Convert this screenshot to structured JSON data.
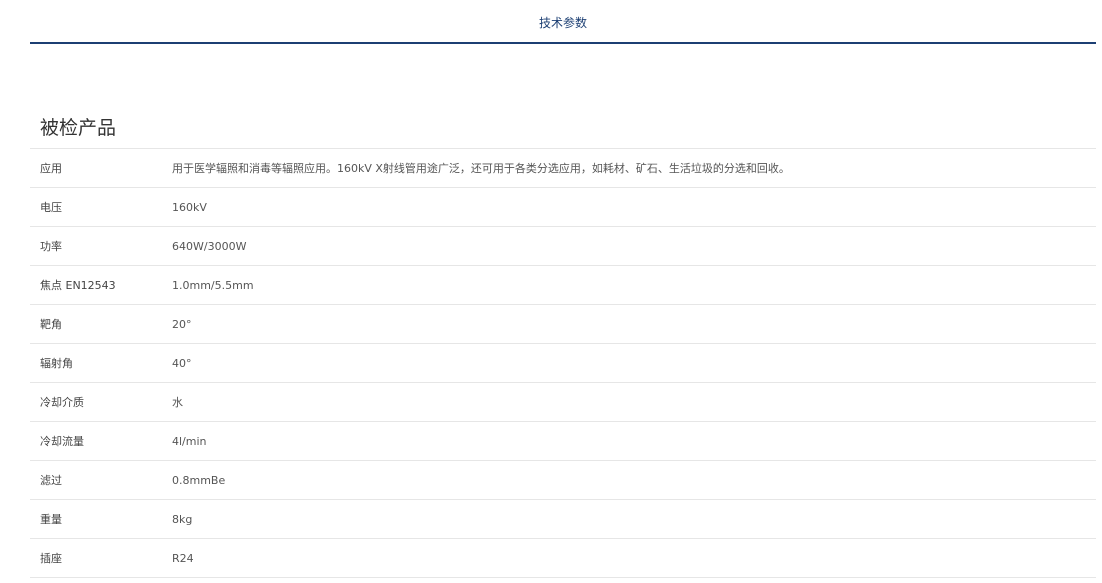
{
  "tabs": {
    "active_label": "技术参数"
  },
  "section": {
    "title": "被检产品"
  },
  "specs": [
    {
      "label": "应用",
      "value": "用于医学辐照和消毒等辐照应用。160kV X射线管用途广泛，还可用于各类分选应用，如耗材、矿石、生活垃圾的分选和回收。"
    },
    {
      "label": "电压",
      "value": "160kV"
    },
    {
      "label": "功率",
      "value": "640W/3000W"
    },
    {
      "label": "焦点 EN12543",
      "value": "1.0mm/5.5mm"
    },
    {
      "label": "靶角",
      "value": "20°"
    },
    {
      "label": "辐射角",
      "value": "40°"
    },
    {
      "label": "冷却介质",
      "value": "水"
    },
    {
      "label": "冷却流量",
      "value": "4l/min"
    },
    {
      "label": "滤过",
      "value": "0.8mmBe"
    },
    {
      "label": "重量",
      "value": "8kg"
    },
    {
      "label": "插座",
      "value": "R24"
    }
  ]
}
